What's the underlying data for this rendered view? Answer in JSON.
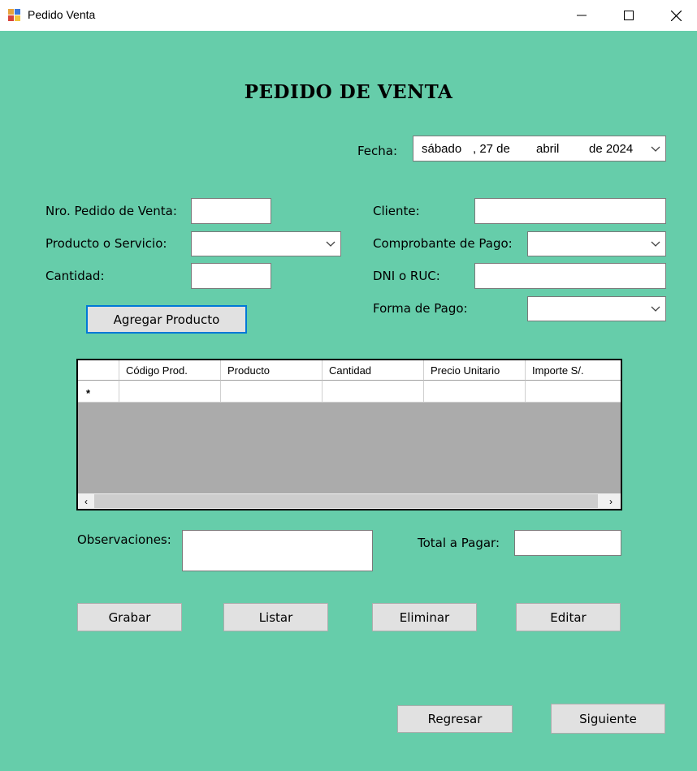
{
  "window": {
    "title": "Pedido Venta",
    "controls": [
      "minimize",
      "maximize",
      "close"
    ]
  },
  "form": {
    "heading": "PEDIDO DE VENTA",
    "fecha": {
      "label": "Fecha:",
      "day_name": "sábado",
      "day": ", 27 de",
      "month": "abril",
      "year": "de 2024"
    },
    "left": {
      "nro_pedido_label": "Nro. Pedido de Venta:",
      "nro_pedido_value": "",
      "producto_label": "Producto o Servicio:",
      "producto_value": "",
      "cantidad_label": "Cantidad:",
      "cantidad_value": "",
      "agregar_button": "Agregar Producto"
    },
    "right": {
      "cliente_label": "Cliente:",
      "cliente_value": "",
      "comprobante_label": "Comprobante de Pago:",
      "comprobante_value": "",
      "dni_label": "DNI o RUC:",
      "dni_value": "",
      "forma_pago_label": "Forma de Pago:",
      "forma_pago_value": ""
    },
    "grid": {
      "columns": [
        "Código Prod.",
        "Producto",
        "Cantidad",
        "Precio Unitario",
        "Importe S/."
      ],
      "new_row_marker": "*",
      "rows": []
    },
    "observaciones_label": "Observaciones:",
    "observaciones_value": "",
    "total_label": "Total a Pagar:",
    "total_value": "",
    "actions": {
      "grabar": "Grabar",
      "listar": "Listar",
      "eliminar": "Eliminar",
      "editar": "Editar"
    },
    "nav": {
      "regresar": "Regresar",
      "siguiente": "Siguiente"
    }
  },
  "colors": {
    "background": "#66cdaa",
    "button": "#e1e1e1",
    "focus_border": "#0078d7",
    "grid_empty": "#ababab"
  }
}
